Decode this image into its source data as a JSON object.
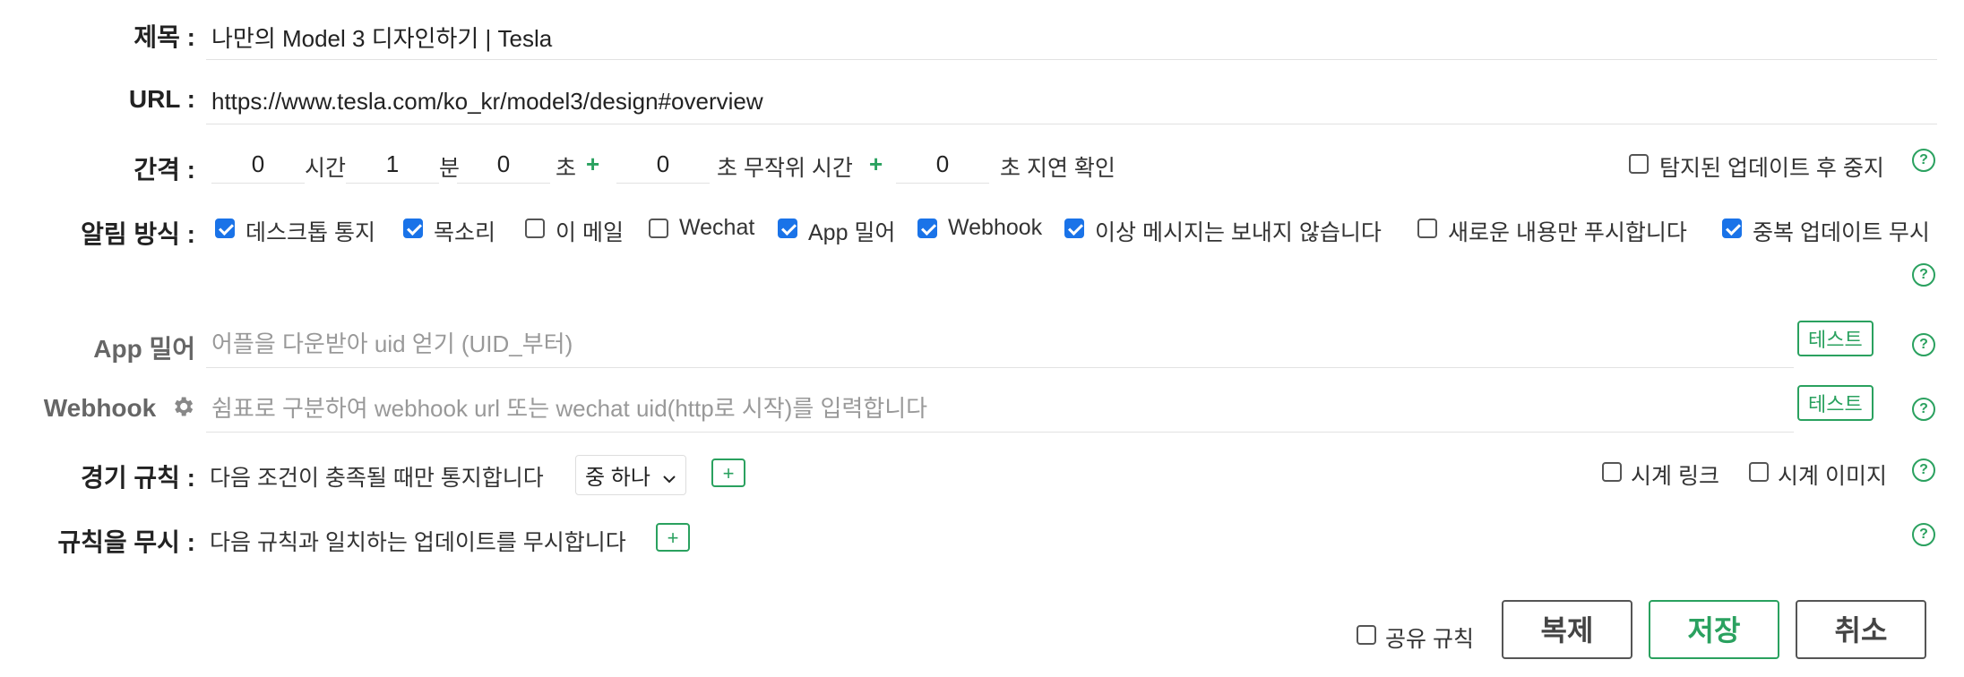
{
  "title_row": {
    "label": "제목 :",
    "value": "나만의 Model 3 디자인하기 | Tesla"
  },
  "url_row": {
    "label": "URL :",
    "value": "https://www.tesla.com/ko_kr/model3/design#overview"
  },
  "interval": {
    "label": "간격 :",
    "hours": "0",
    "hours_unit": "시간",
    "minutes": "1",
    "minutes_unit": "분",
    "seconds": "0",
    "seconds_unit": "초",
    "plus1": "+",
    "random_seconds": "0",
    "random_unit": "초 무작위 시간",
    "plus2": "+",
    "delay_seconds": "0",
    "delay_unit": "초 지연 확인",
    "stop_after_update": "탐지된 업데이트 후 중지"
  },
  "notify": {
    "label": "알림 방식 :",
    "options": [
      {
        "label": "데스크톱 통지",
        "checked": true
      },
      {
        "label": "목소리",
        "checked": true
      },
      {
        "label": "이 메일",
        "checked": false
      },
      {
        "label": "Wechat",
        "checked": false
      },
      {
        "label": "App 밀어",
        "checked": true
      },
      {
        "label": "Webhook",
        "checked": true
      },
      {
        "label": "이상 메시지는 보내지 않습니다",
        "checked": true
      },
      {
        "label": "새로운 내용만 푸시합니다",
        "checked": false
      },
      {
        "label": "중복 업데이트 무시",
        "checked": true
      }
    ]
  },
  "app_push": {
    "label": "App 밀어",
    "placeholder": "어플을 다운받아 uid 얻기 (UID_부터)",
    "test": "테스트"
  },
  "webhook": {
    "label": "Webhook",
    "placeholder": "쉼표로 구분하여 webhook url 또는 wechat uid(http로 시작)를 입력합니다",
    "test": "테스트"
  },
  "alert_rule": {
    "label": "경기 규칙 :",
    "text": "다음 조건이 충족될 때만 통지합니다",
    "select": "중 하나",
    "plus": "+",
    "watch_link": "시계 링크",
    "watch_image": "시계 이미지"
  },
  "ignore_rule": {
    "label": "규칙을 무시 :",
    "text": "다음 규칙과 일치하는 업데이트를 무시합니다",
    "plus": "+"
  },
  "footer": {
    "share": "공유 규칙",
    "copy": "복제",
    "save": "저장",
    "cancel": "취소"
  },
  "help": "?",
  "colors": {
    "accent": "#2aa15f",
    "check": "#1a73e8"
  }
}
